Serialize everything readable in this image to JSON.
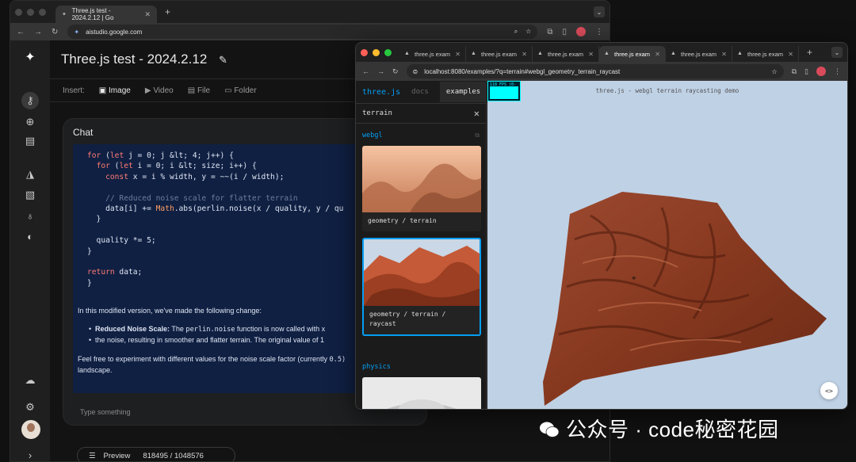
{
  "back_browser": {
    "tab_title": "Three.js test - 2024.2.12 | Go",
    "url": "aistudio.google.com"
  },
  "app": {
    "title": "Three.js test - 2024.2.12",
    "insert": {
      "label": "Insert:",
      "items": [
        "Image",
        "Video",
        "File",
        "Folder"
      ],
      "active": "Image"
    },
    "chat": {
      "title": "Chat",
      "code_lines": [
        "for (let j = 0; j &lt; 4; j++) {",
        "  for (let i = 0; i &lt; size; i++) {",
        "    const x = i % width, y = ~~(i / width);",
        "",
        "    // Reduced noise scale for flatter terrain",
        "    data[i] += Math.abs(perlin.noise(x / quality, y / qu",
        "  }",
        "",
        "  quality *= 5;",
        "}",
        "",
        "return data;",
        "}"
      ],
      "message": {
        "intro": "In this modified version, we've made the following change:",
        "bullet_title": "Reduced Noise Scale:",
        "bullet_pre": "The",
        "bullet_code": "perlin.noise",
        "bullet_post": "function is now called with x",
        "bullet_line2": "the noise, resulting in smoother and flatter terrain. The original value of 1",
        "outro_pre": "Feel free to experiment with different values for the noise scale factor (currently",
        "outro_code": "0.5)",
        "outro_line2": "landscape."
      },
      "input_placeholder": "Type something"
    },
    "preview": {
      "label": "Preview",
      "tokens": "818495 / 1048576"
    }
  },
  "front_browser": {
    "tabs": [
      "three.js exam",
      "three.js exam",
      "three.js exam",
      "three.js exam",
      "three.js exam",
      "three.js exam"
    ],
    "active_tab": 3,
    "url": "localhost:8080/examples/?q=terrain#webgl_geometry_terrain_raycast",
    "sidebar": {
      "brand": "three.js",
      "docs": "docs",
      "examples": "examples",
      "search_value": "terrain",
      "categories": [
        {
          "name": "webgl",
          "cards": [
            {
              "label": "geometry / terrain",
              "selected": false
            },
            {
              "label": "geometry / terrain / raycast",
              "selected": true
            }
          ]
        },
        {
          "name": "physics",
          "cards": [
            {
              "label": "",
              "selected": false
            }
          ]
        }
      ]
    },
    "fps": "118 FPS (0-120)",
    "viewport_info": "three.js - webgl terrain raycasting demo",
    "code_button": "<>"
  },
  "watermark": "公众号 · code秘密花园",
  "colors": {
    "accent": "#049ef4",
    "code_bg": "#102043",
    "viewport_bg": "#bfd1e5",
    "terrain": "#8a3a26"
  }
}
